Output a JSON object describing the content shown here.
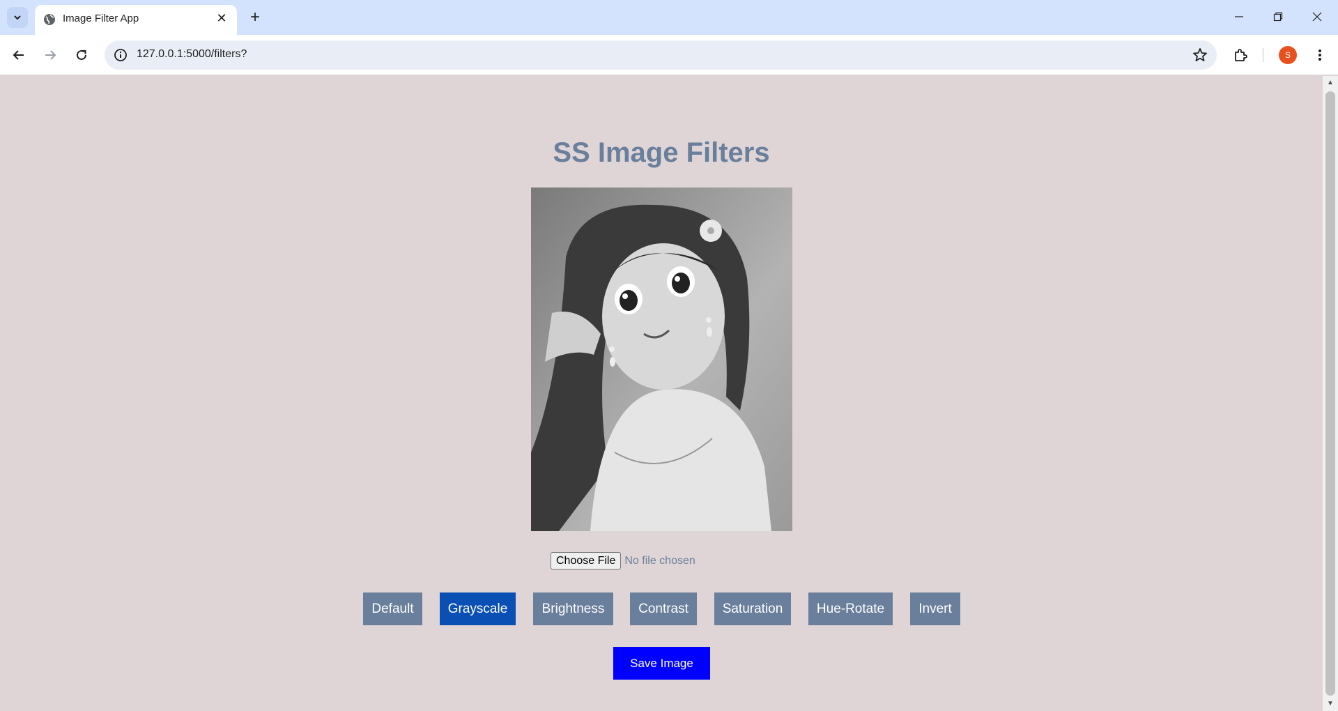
{
  "browser": {
    "tab_title": "Image Filter App",
    "url": "127.0.0.1:5000/filters?",
    "profile_initial": "S"
  },
  "page": {
    "title": "SS Image Filters",
    "file_input": {
      "button_label": "Choose File",
      "status": "No file chosen"
    },
    "filters": [
      {
        "label": "Default",
        "active": false
      },
      {
        "label": "Grayscale",
        "active": true
      },
      {
        "label": "Brightness",
        "active": false
      },
      {
        "label": "Contrast",
        "active": false
      },
      {
        "label": "Saturation",
        "active": false
      },
      {
        "label": "Hue-Rotate",
        "active": false
      },
      {
        "label": "Invert",
        "active": false
      }
    ],
    "save_label": "Save Image"
  },
  "colors": {
    "page_background": "#e0d5d6",
    "title_color": "#6a7f9c",
    "filter_button": "#6a7f9c",
    "filter_button_active": "#0a4fb4",
    "save_button": "#0000ff"
  }
}
